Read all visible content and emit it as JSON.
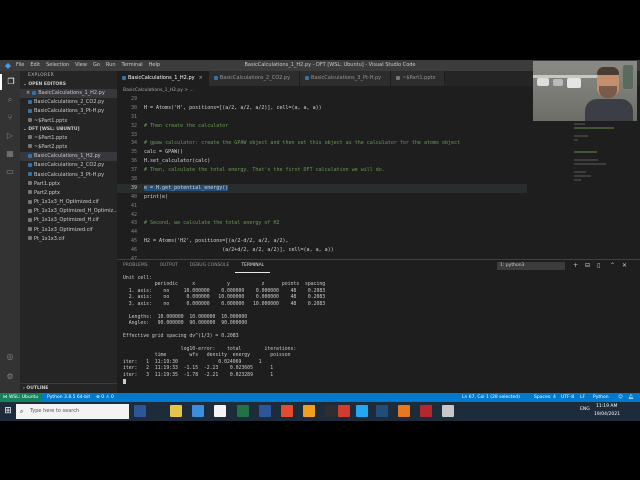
{
  "window_title": "BasicCalculations_1_H2.py - DFT [WSL: Ubuntu] - Visual Studio Code",
  "menu": [
    "File",
    "Edit",
    "Selection",
    "View",
    "Go",
    "Run",
    "Terminal",
    "Help"
  ],
  "sidebar": {
    "header": "EXPLORER",
    "open_editors_title": "OPEN EDITORS",
    "open_editors": [
      {
        "label": "BasicCalculations_1_H2.py",
        "kind": "py",
        "close": "×"
      },
      {
        "label": "BasicCalculations_2_CO2.py",
        "kind": "py",
        "close": ""
      },
      {
        "label": "BasicCalculations_3_Pt-H.py",
        "kind": "py",
        "close": ""
      },
      {
        "label": "~$Part1.pptx",
        "kind": "file",
        "close": ""
      }
    ],
    "folder_title": "DFT [WSL: UBUNTU]",
    "files": [
      {
        "label": "~$Part1.pptx",
        "kind": "file"
      },
      {
        "label": "~$Part2.pptx",
        "kind": "file"
      },
      {
        "label": "BasicCalculations_1_H2.py",
        "kind": "py"
      },
      {
        "label": "BasicCalculations_2_CO2.py",
        "kind": "py"
      },
      {
        "label": "BasicCalculations_3_Pt-H.py",
        "kind": "py"
      },
      {
        "label": "Part1.pptx",
        "kind": "file"
      },
      {
        "label": "Part2.pptx",
        "kind": "file"
      },
      {
        "label": "Pt_1x1x3_H_Optimized.cif",
        "kind": "file"
      },
      {
        "label": "Pt_1x1x3_Optimized_H_Optimiz...",
        "kind": "file"
      },
      {
        "label": "Pt_1x1x3_Optimized_H.cif",
        "kind": "file"
      },
      {
        "label": "Pt_1x1x3_Optimized.cif",
        "kind": "file"
      },
      {
        "label": "Pt_1x1x3.cif",
        "kind": "file"
      }
    ],
    "outline": "OUTLINE"
  },
  "tabs": [
    {
      "label": "BasicCalculations_1_H2.py",
      "active": true,
      "close": "×"
    },
    {
      "label": "BasicCalculations_2_CO2.py",
      "active": false,
      "close": ""
    },
    {
      "label": "BasicCalculations_3_Pt-H.py",
      "active": false,
      "close": ""
    },
    {
      "label": "~$Part1.pptx",
      "active": false,
      "close": ""
    }
  ],
  "breadcrumb": "BasicCalculations_1_H2.py > ...",
  "editor": {
    "lines": [
      {
        "n": "29",
        "text": "",
        "type": "txt"
      },
      {
        "n": "30",
        "text": "H = Atoms('H', positions=[(a/2, a/2, a/2)], cell=(a, a, a))",
        "type": "txt"
      },
      {
        "n": "31",
        "text": "",
        "type": "txt"
      },
      {
        "n": "32",
        "text": "# Then create the calculator",
        "type": "cm"
      },
      {
        "n": "33",
        "text": "",
        "type": "txt"
      },
      {
        "n": "34",
        "text": "# gpaw calculator: create the GPAW object and then set this object as the calculator for the atoms object",
        "type": "cm"
      },
      {
        "n": "35",
        "text": "calc = GPAW()",
        "type": "txt"
      },
      {
        "n": "36",
        "text": "H.set_calculator(calc)",
        "type": "txt"
      },
      {
        "n": "37",
        "text": "# Then, calculate the total energy. That's the first DFT calculation we will do.",
        "type": "cm"
      },
      {
        "n": "38",
        "text": "",
        "type": "txt"
      },
      {
        "n": "39",
        "text": "e = H.get_potential_energy()",
        "type": "sel"
      },
      {
        "n": "40",
        "text": "print(e)",
        "type": "txt"
      },
      {
        "n": "41",
        "text": "",
        "type": "txt"
      },
      {
        "n": "42",
        "text": "",
        "type": "txt"
      },
      {
        "n": "43",
        "text": "# Second, we calculate the total energy of H2",
        "type": "cm"
      },
      {
        "n": "44",
        "text": "",
        "type": "txt"
      },
      {
        "n": "45",
        "text": "H2 = Atoms('H2', positions=[(a/2-d/2, a/2, a/2),",
        "type": "txt"
      },
      {
        "n": "46",
        "text": "                          (a/2+d/2, a/2, a/2)], cell=(a, a, a))",
        "type": "txt"
      },
      {
        "n": "47",
        "text": "",
        "type": "txt"
      },
      {
        "n": "48",
        "text": "H2.set_calculator(calc)",
        "type": "txt"
      },
      {
        "n": "49",
        "text": "eTotal = H2.get_potential_energy()",
        "type": "txt"
      },
      {
        "n": "50",
        "text": "print(eTotal)",
        "type": "txt"
      }
    ],
    "current_line": "39"
  },
  "panel": {
    "tabs": [
      "PROBLEMS",
      "OUTPUT",
      "DEBUG CONSOLE",
      "TERMINAL"
    ],
    "active_tab": "TERMINAL",
    "terminal_select": "1: python3",
    "actions": [
      "+",
      "⊟",
      "🗑",
      "^",
      "×"
    ],
    "terminal_lines": [
      "Unit cell:",
      "           periodic     x           y           z      points  spacing",
      "  1. axis:    no     10.000000    0.000000    0.000000    48    0.2083",
      "  2. axis:    no      0.000000   10.000000    0.000000    48    0.2083",
      "  3. axis:    no      0.000000    0.000000   10.000000    48    0.2083",
      "",
      "  Lengths:  10.000000  10.000000  10.000000",
      "  Angles:   90.000000  90.000000  90.000000",
      "",
      "Effective grid spacing dv^(1/3) = 0.2083",
      "",
      "                    log10-error:    total        iterations:",
      "           time        wfs   density  energy       poisson",
      "iter:   1  11:19:30              0.024069      1",
      "iter:   2  11:19:33  -1.15  -2.23    0.023605      1",
      "iter:   3  11:19:35  -1.78  -2.21    0.023289      1"
    ]
  },
  "statusbar": {
    "remote": "WSL: Ubuntu",
    "python": "Python 3.8.5 64-bit",
    "errors": "⊗ 0 ⚠ 0",
    "position": "Ln 67, Col 1 (28 selected)",
    "spaces": "Spaces: 4",
    "encoding": "UTF-8",
    "eol": "LF",
    "language": "Python"
  },
  "taskbar": {
    "search_placeholder": "Type here to search",
    "time": "11:19 AM",
    "date": "19/04/2021",
    "lang": "ENG"
  },
  "colors": {
    "statusbar": "#007acc",
    "remote": "#16825d",
    "selection": "#264f78",
    "taskbar": "#1d2b3a"
  }
}
